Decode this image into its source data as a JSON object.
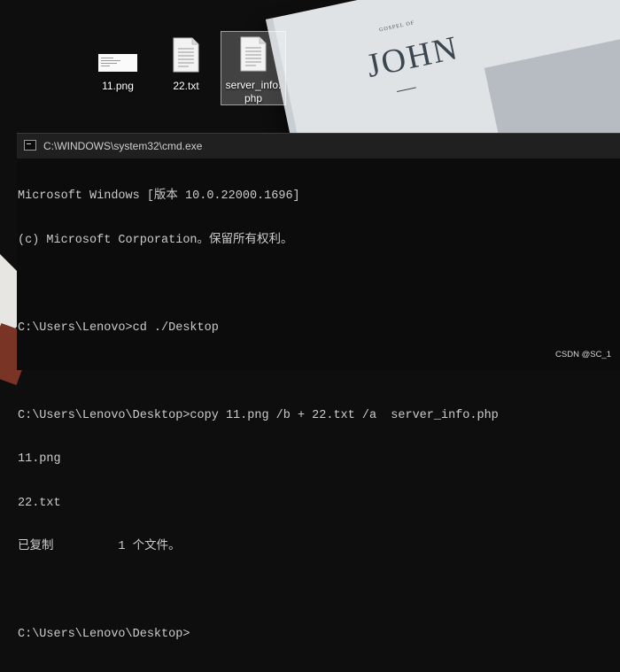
{
  "desktop": {
    "icons": [
      {
        "label": "11.png",
        "kind": "image-file-icon"
      },
      {
        "label": "22.txt",
        "kind": "text-file-icon"
      },
      {
        "label": "server_info.\nphp",
        "kind": "text-file-icon",
        "selected": true
      }
    ],
    "wallpaper": {
      "book_small_title": "GOSPEL OF",
      "book_title": "JOHN"
    }
  },
  "cmd": {
    "title": "C:\\WINDOWS\\system32\\cmd.exe",
    "lines": [
      "Microsoft Windows [版本 10.0.22000.1696]",
      "(c) Microsoft Corporation。保留所有权利。",
      "",
      "C:\\Users\\Lenovo>cd ./Desktop",
      "",
      "C:\\Users\\Lenovo\\Desktop>copy 11.png /b + 22.txt /a  server_info.php",
      "11.png",
      "22.txt",
      "已复制         1 个文件。",
      "",
      "C:\\Users\\Lenovo\\Desktop>"
    ]
  },
  "watermark": "CSDN @SC_1",
  "colors": {
    "console_bg": "#0c0c0c",
    "console_text": "#cccccc",
    "titlebar": "#202020"
  }
}
